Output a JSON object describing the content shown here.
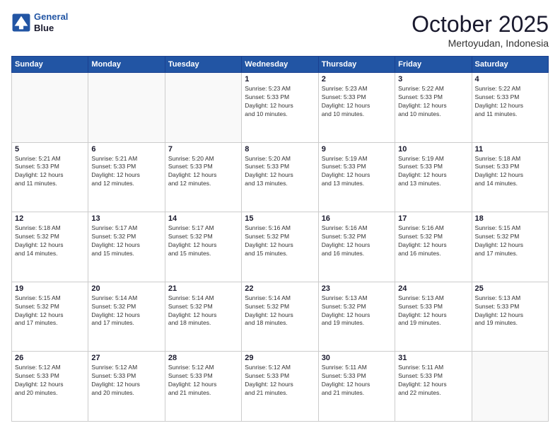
{
  "header": {
    "logo_line1": "General",
    "logo_line2": "Blue",
    "month": "October 2025",
    "location": "Mertoyudan, Indonesia"
  },
  "weekdays": [
    "Sunday",
    "Monday",
    "Tuesday",
    "Wednesday",
    "Thursday",
    "Friday",
    "Saturday"
  ],
  "weeks": [
    [
      {
        "day": "",
        "info": ""
      },
      {
        "day": "",
        "info": ""
      },
      {
        "day": "",
        "info": ""
      },
      {
        "day": "1",
        "info": "Sunrise: 5:23 AM\nSunset: 5:33 PM\nDaylight: 12 hours\nand 10 minutes."
      },
      {
        "day": "2",
        "info": "Sunrise: 5:23 AM\nSunset: 5:33 PM\nDaylight: 12 hours\nand 10 minutes."
      },
      {
        "day": "3",
        "info": "Sunrise: 5:22 AM\nSunset: 5:33 PM\nDaylight: 12 hours\nand 10 minutes."
      },
      {
        "day": "4",
        "info": "Sunrise: 5:22 AM\nSunset: 5:33 PM\nDaylight: 12 hours\nand 11 minutes."
      }
    ],
    [
      {
        "day": "5",
        "info": "Sunrise: 5:21 AM\nSunset: 5:33 PM\nDaylight: 12 hours\nand 11 minutes."
      },
      {
        "day": "6",
        "info": "Sunrise: 5:21 AM\nSunset: 5:33 PM\nDaylight: 12 hours\nand 12 minutes."
      },
      {
        "day": "7",
        "info": "Sunrise: 5:20 AM\nSunset: 5:33 PM\nDaylight: 12 hours\nand 12 minutes."
      },
      {
        "day": "8",
        "info": "Sunrise: 5:20 AM\nSunset: 5:33 PM\nDaylight: 12 hours\nand 13 minutes."
      },
      {
        "day": "9",
        "info": "Sunrise: 5:19 AM\nSunset: 5:33 PM\nDaylight: 12 hours\nand 13 minutes."
      },
      {
        "day": "10",
        "info": "Sunrise: 5:19 AM\nSunset: 5:33 PM\nDaylight: 12 hours\nand 13 minutes."
      },
      {
        "day": "11",
        "info": "Sunrise: 5:18 AM\nSunset: 5:33 PM\nDaylight: 12 hours\nand 14 minutes."
      }
    ],
    [
      {
        "day": "12",
        "info": "Sunrise: 5:18 AM\nSunset: 5:32 PM\nDaylight: 12 hours\nand 14 minutes."
      },
      {
        "day": "13",
        "info": "Sunrise: 5:17 AM\nSunset: 5:32 PM\nDaylight: 12 hours\nand 15 minutes."
      },
      {
        "day": "14",
        "info": "Sunrise: 5:17 AM\nSunset: 5:32 PM\nDaylight: 12 hours\nand 15 minutes."
      },
      {
        "day": "15",
        "info": "Sunrise: 5:16 AM\nSunset: 5:32 PM\nDaylight: 12 hours\nand 15 minutes."
      },
      {
        "day": "16",
        "info": "Sunrise: 5:16 AM\nSunset: 5:32 PM\nDaylight: 12 hours\nand 16 minutes."
      },
      {
        "day": "17",
        "info": "Sunrise: 5:16 AM\nSunset: 5:32 PM\nDaylight: 12 hours\nand 16 minutes."
      },
      {
        "day": "18",
        "info": "Sunrise: 5:15 AM\nSunset: 5:32 PM\nDaylight: 12 hours\nand 17 minutes."
      }
    ],
    [
      {
        "day": "19",
        "info": "Sunrise: 5:15 AM\nSunset: 5:32 PM\nDaylight: 12 hours\nand 17 minutes."
      },
      {
        "day": "20",
        "info": "Sunrise: 5:14 AM\nSunset: 5:32 PM\nDaylight: 12 hours\nand 17 minutes."
      },
      {
        "day": "21",
        "info": "Sunrise: 5:14 AM\nSunset: 5:32 PM\nDaylight: 12 hours\nand 18 minutes."
      },
      {
        "day": "22",
        "info": "Sunrise: 5:14 AM\nSunset: 5:32 PM\nDaylight: 12 hours\nand 18 minutes."
      },
      {
        "day": "23",
        "info": "Sunrise: 5:13 AM\nSunset: 5:32 PM\nDaylight: 12 hours\nand 19 minutes."
      },
      {
        "day": "24",
        "info": "Sunrise: 5:13 AM\nSunset: 5:33 PM\nDaylight: 12 hours\nand 19 minutes."
      },
      {
        "day": "25",
        "info": "Sunrise: 5:13 AM\nSunset: 5:33 PM\nDaylight: 12 hours\nand 19 minutes."
      }
    ],
    [
      {
        "day": "26",
        "info": "Sunrise: 5:12 AM\nSunset: 5:33 PM\nDaylight: 12 hours\nand 20 minutes."
      },
      {
        "day": "27",
        "info": "Sunrise: 5:12 AM\nSunset: 5:33 PM\nDaylight: 12 hours\nand 20 minutes."
      },
      {
        "day": "28",
        "info": "Sunrise: 5:12 AM\nSunset: 5:33 PM\nDaylight: 12 hours\nand 21 minutes."
      },
      {
        "day": "29",
        "info": "Sunrise: 5:12 AM\nSunset: 5:33 PM\nDaylight: 12 hours\nand 21 minutes."
      },
      {
        "day": "30",
        "info": "Sunrise: 5:11 AM\nSunset: 5:33 PM\nDaylight: 12 hours\nand 21 minutes."
      },
      {
        "day": "31",
        "info": "Sunrise: 5:11 AM\nSunset: 5:33 PM\nDaylight: 12 hours\nand 22 minutes."
      },
      {
        "day": "",
        "info": ""
      }
    ]
  ]
}
